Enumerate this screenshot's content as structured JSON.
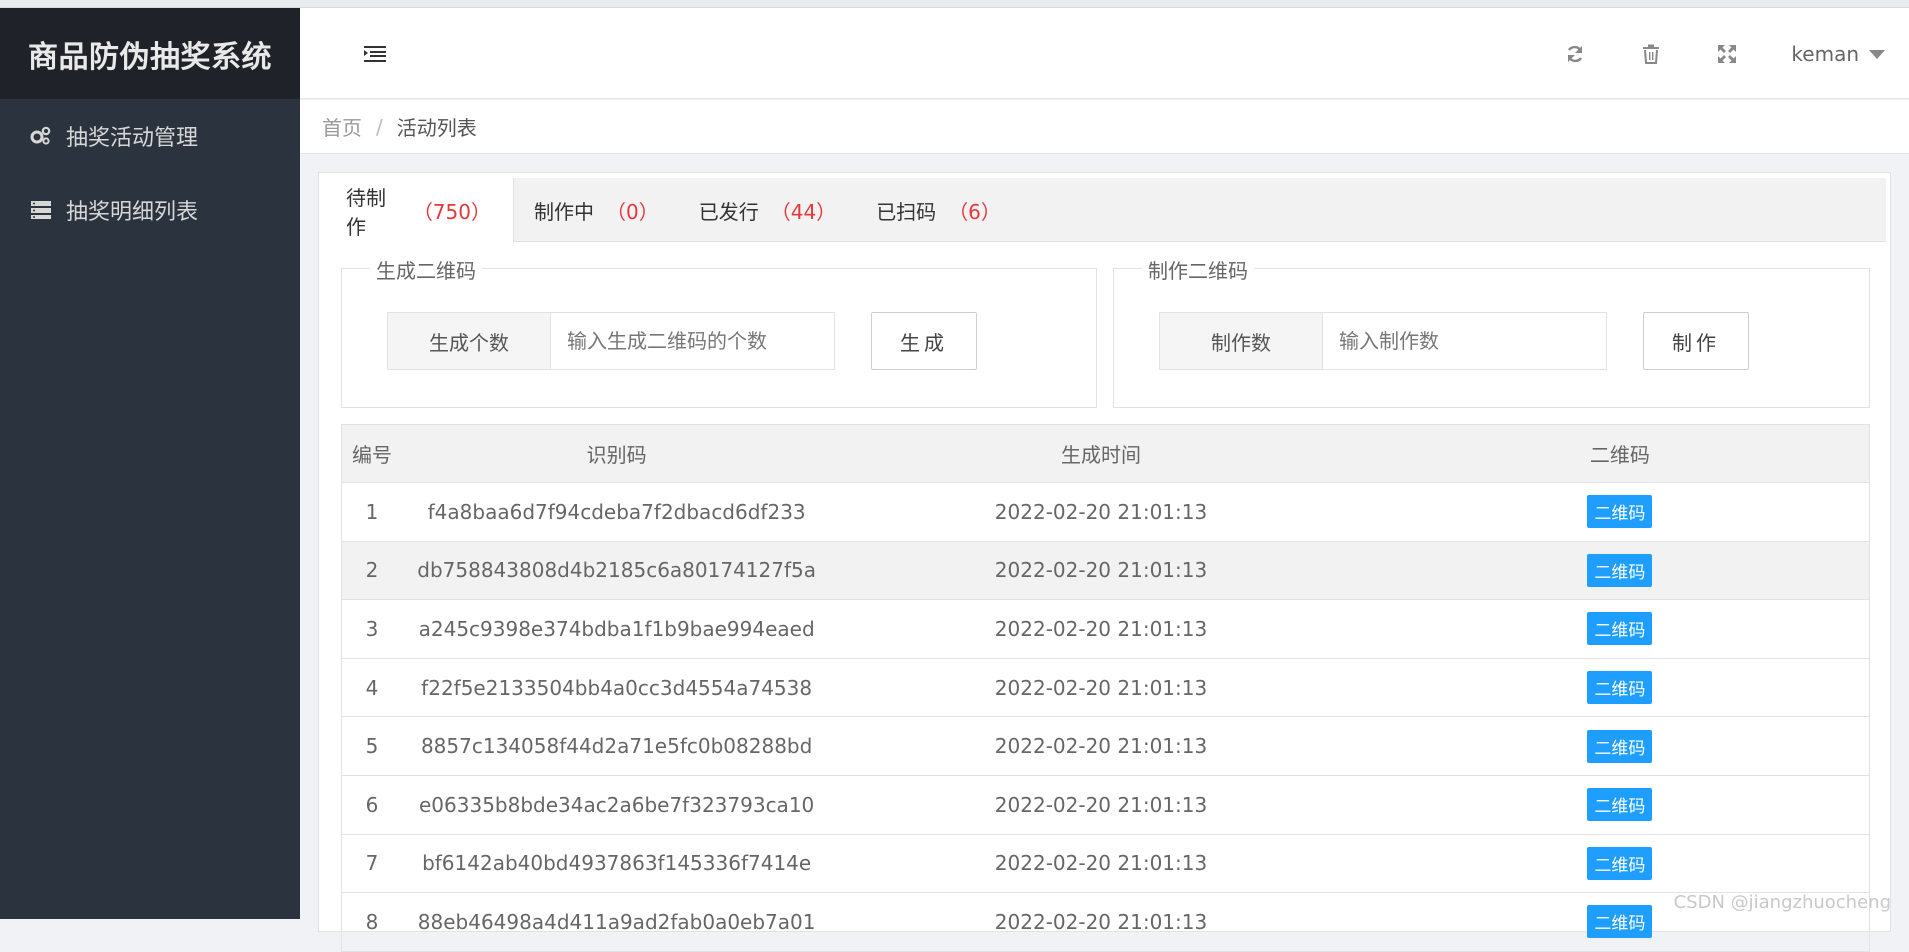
{
  "sidebar": {
    "app_title": "商品防伪抽奖系统",
    "items": [
      {
        "label": "抽奖活动管理",
        "icon": "gears-icon"
      },
      {
        "label": "抽奖明细列表",
        "icon": "server-icon"
      }
    ]
  },
  "header": {
    "icons": [
      "hamburger-menu-icon",
      "refresh-icon",
      "trash-icon",
      "fullscreen-icon"
    ],
    "username": "keman"
  },
  "breadcrumb": {
    "home": "首页",
    "separator": "/",
    "current": "活动列表"
  },
  "tabs": [
    {
      "label": "待制作",
      "count": "（750）",
      "active": true
    },
    {
      "label": "制作中",
      "count": "（0）",
      "active": false
    },
    {
      "label": "已发行",
      "count": "（44）",
      "active": false
    },
    {
      "label": "已扫码",
      "count": "（6）",
      "active": false
    }
  ],
  "generate": {
    "legend": "生成二维码",
    "addon": "生成个数",
    "placeholder": "输入生成二维码的个数",
    "button": "生成"
  },
  "make": {
    "legend": "制作二维码",
    "addon": "制作数",
    "placeholder": "输入制作数",
    "button": "制作"
  },
  "table": {
    "headers": [
      "编号",
      "识别码",
      "生成时间",
      "二维码"
    ],
    "qr_label": "二维码",
    "rows": [
      {
        "id": "1",
        "code": "f4a8baa6d7f94cdeba7f2dbacd6df233",
        "time": "2022-02-20 21:01:13"
      },
      {
        "id": "2",
        "code": "db758843808d4b2185c6a80174127f5a",
        "time": "2022-02-20 21:01:13"
      },
      {
        "id": "3",
        "code": "a245c9398e374bdba1f1b9bae994eaed",
        "time": "2022-02-20 21:01:13"
      },
      {
        "id": "4",
        "code": "f22f5e2133504bb4a0cc3d4554a74538",
        "time": "2022-02-20 21:01:13"
      },
      {
        "id": "5",
        "code": "8857c134058f44d2a71e5fc0b08288bd",
        "time": "2022-02-20 21:01:13"
      },
      {
        "id": "6",
        "code": "e06335b8bde34ac2a6be7f323793ca10",
        "time": "2022-02-20 21:01:13"
      },
      {
        "id": "7",
        "code": "bf6142ab40bd4937863f145336f7414e",
        "time": "2022-02-20 21:01:13"
      },
      {
        "id": "8",
        "code": "88eb46498a4d411a9ad2fab0a0eb7a01",
        "time": "2022-02-20 21:01:13"
      }
    ]
  },
  "watermark": "CSDN @jiangzhuocheng",
  "colors": {
    "sidebar_bg": "#2b333e",
    "logo_bg": "#1f2329",
    "accent_blue": "#1e9fff",
    "count_red": "#e4393c"
  }
}
